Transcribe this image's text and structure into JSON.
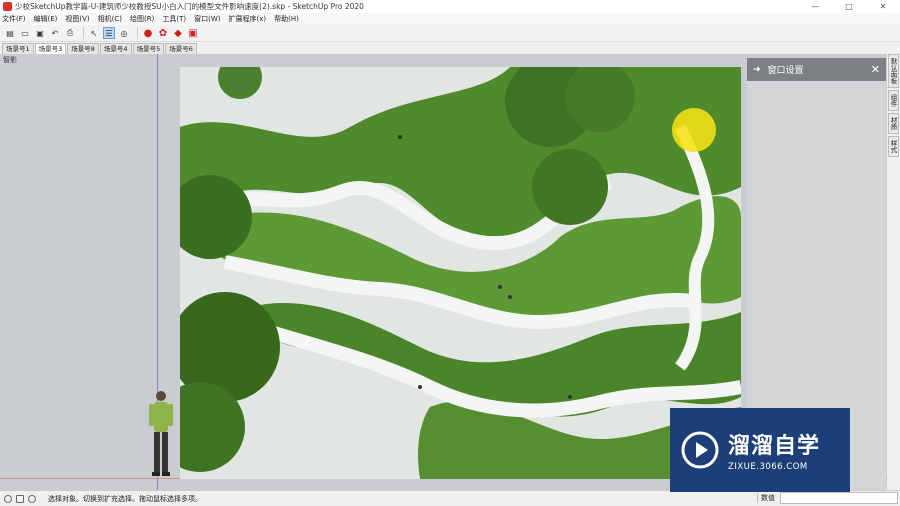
{
  "window": {
    "title": "少校SketchUp教学篇-U-建筑师少校教授SU小白入门的模型文件影响速度(2).skp - SketchUp Pro 2020",
    "minimize": "—",
    "maximize": "□",
    "close": "✕"
  },
  "menu": [
    "文件(F)",
    "编辑(E)",
    "视图(V)",
    "相机(C)",
    "绘图(R)",
    "工具(T)",
    "窗口(W)",
    "扩展程序(x)",
    "帮助(H)"
  ],
  "toolbar": [
    {
      "icon": "new-file-icon",
      "glyph": "▤"
    },
    {
      "icon": "open-file-icon",
      "glyph": "▭"
    },
    {
      "icon": "save-icon",
      "glyph": "▣"
    },
    {
      "icon": "undo-icon",
      "glyph": "↶"
    },
    {
      "icon": "print-icon",
      "glyph": "⎙"
    },
    {
      "icon": "select-icon",
      "glyph": "↖"
    },
    {
      "icon": "outliner-icon",
      "glyph": "☰"
    },
    {
      "icon": "component-icon",
      "glyph": "◎"
    },
    {
      "icon": "ruby-icon-1",
      "glyph": "●"
    },
    {
      "icon": "ruby-icon-2",
      "glyph": "✿"
    },
    {
      "icon": "ruby-icon-3",
      "glyph": "◆"
    },
    {
      "icon": "ruby-icon-4",
      "glyph": "▣"
    }
  ],
  "scene_tabs": [
    "场景号1",
    "场景号3",
    "场景号8",
    "场景号4",
    "场景号5",
    "场景号6"
  ],
  "viewport": {
    "label": "智影"
  },
  "tray": {
    "title": "窗口设置",
    "pin": "➜",
    "close": "✕"
  },
  "side_tabs": [
    "默认面板",
    "组件",
    "材质",
    "样式"
  ],
  "status": {
    "text": "选择对象。切换到扩充选择。拖动鼠标选择多项。",
    "measure_label": "数值"
  },
  "watermark": {
    "title": "溜溜自学",
    "url": "ZIXUE.3066.COM"
  },
  "colors": {
    "viewport": "#c9cdd1",
    "tray_header": "#7c8185",
    "highlight": "#f5e214",
    "watermark_bg": "#1d3f78"
  }
}
